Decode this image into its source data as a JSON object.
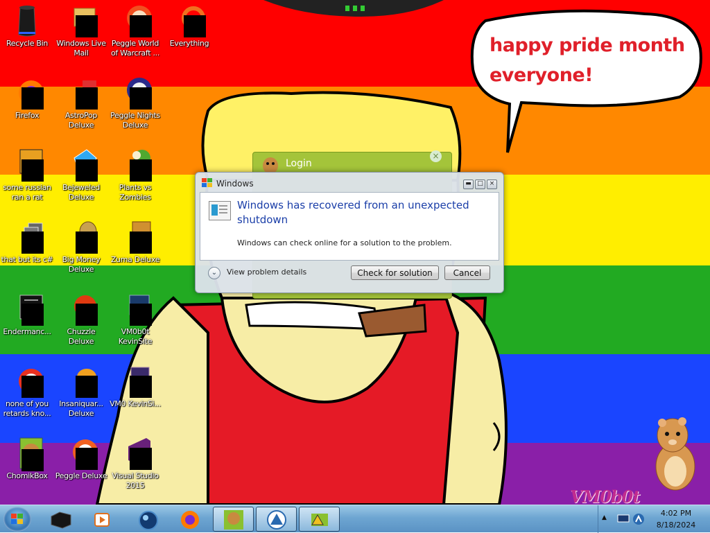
{
  "wallpaper": {
    "stripe_colors": [
      "#ff0000",
      "#ff8800",
      "#ffee00",
      "#22aa22",
      "#1a45ff",
      "#8a1fa8"
    ],
    "bubble_text_line1": "happy pride month",
    "bubble_text_line2": "everyone!",
    "watermark": "VM0b0t"
  },
  "desktop_icons": [
    {
      "label": "Recycle Bin",
      "icon": "recycle-bin-icon"
    },
    {
      "label": "Windows Live Mail",
      "icon": "mail-icon"
    },
    {
      "label": "Peggle World of Warcraft ...",
      "icon": "peggle-icon"
    },
    {
      "label": "Everything",
      "icon": "search-icon"
    },
    {
      "label": "Firefox",
      "icon": "firefox-icon"
    },
    {
      "label": "AstroPop Deluxe",
      "icon": "game-icon"
    },
    {
      "label": "Peggle Nights Deluxe",
      "icon": "peggle-icon"
    },
    {
      "label": "some russian ran a rat",
      "icon": "app-icon"
    },
    {
      "label": "Bejeweled Deluxe",
      "icon": "gem-icon"
    },
    {
      "label": "Plants vs Zombies",
      "icon": "plant-icon"
    },
    {
      "label": "that but its c#",
      "icon": "app-icon"
    },
    {
      "label": "Big Money Deluxe",
      "icon": "money-icon"
    },
    {
      "label": "Zuma Deluxe",
      "icon": "zuma-icon"
    },
    {
      "label": "Endermanc...",
      "icon": "terminal-icon"
    },
    {
      "label": "Chuzzle Deluxe",
      "icon": "chuzzle-icon"
    },
    {
      "label": "VM0b0t KevinSite",
      "icon": "web-icon"
    },
    {
      "label": "none of you retards kno...",
      "icon": "app-icon"
    },
    {
      "label": "Insaniquar... Deluxe",
      "icon": "fish-icon"
    },
    {
      "label": "VM0 KevinSi...",
      "icon": "web-icon"
    },
    {
      "label": "ChomikBox",
      "icon": "hamster-icon"
    },
    {
      "label": "Peggle Deluxe",
      "icon": "peggle-icon"
    },
    {
      "label": "Visual Studio 2015",
      "icon": "visual-studio-icon"
    }
  ],
  "login_window": {
    "title": "Login",
    "close_glyph": "×"
  },
  "dialog": {
    "title": "Windows",
    "heading": "Windows has recovered from an unexpected shutdown",
    "message": "Windows can check online for a solution to the problem.",
    "details_label": "View problem details",
    "check_button": "Check for solution",
    "cancel_button": "Cancel",
    "chevron_glyph": "⌄",
    "min_glyph": "▬",
    "max_glyph": "□",
    "close_glyph": "×"
  },
  "taskbar": {
    "items": [
      "start-orb",
      "black-box-app",
      "media-player",
      "globe-app",
      "firefox",
      "chomikbox",
      "app-triangle",
      "app-folder"
    ],
    "time": "4:02 PM",
    "date": "8/18/2024",
    "tray_arrow": "▲"
  }
}
